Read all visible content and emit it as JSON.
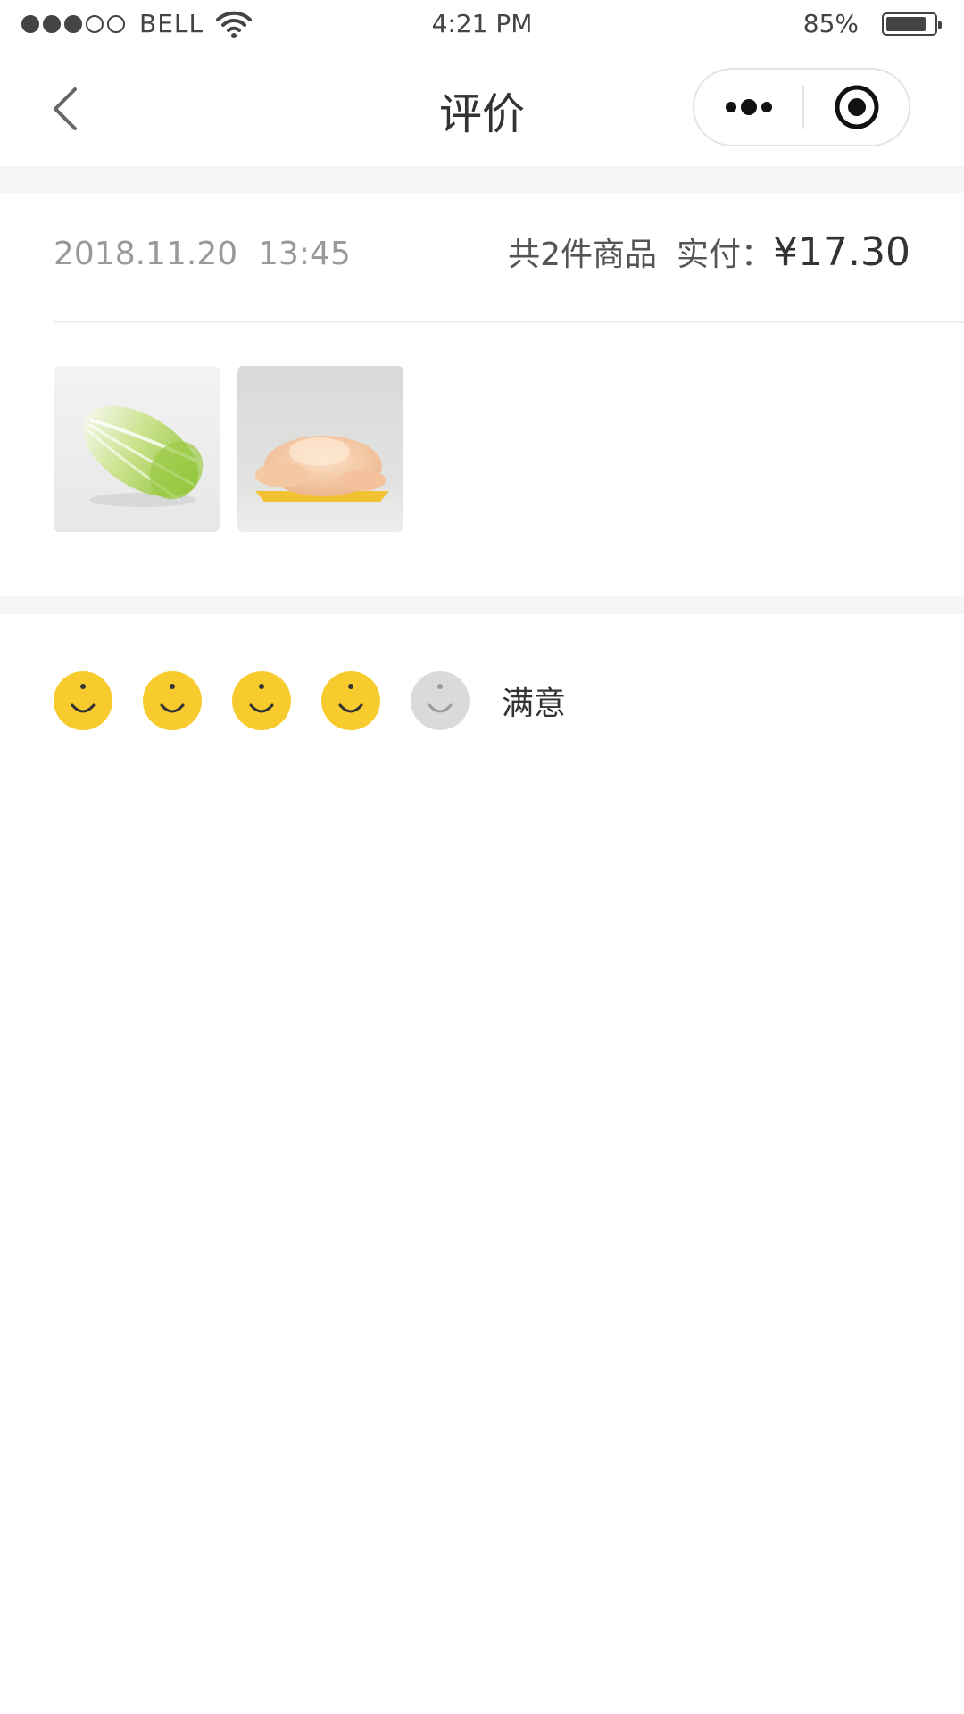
{
  "status_bar": {
    "carrier": "BELL",
    "time": "4:21 PM",
    "battery": "85%",
    "battery_level": 0.85,
    "signal_strength": 3,
    "signal_total": 5
  },
  "nav": {
    "title": "评价",
    "back_icon": "chevron-left-icon",
    "more_icon": "more-dots-icon",
    "close_icon": "target-close-icon"
  },
  "order": {
    "date": "2018.11.20",
    "time": "13:45",
    "count_text": "共2件商品",
    "paid_label": "实付：",
    "amount": "¥17.30",
    "items": [
      {
        "icon": "cabbage-image"
      },
      {
        "icon": "chicken-image"
      }
    ]
  },
  "rating": {
    "value": 4,
    "max": 5,
    "label": "满意",
    "active_color": "#F7CB2D",
    "inactive_color": "#DADADA"
  }
}
